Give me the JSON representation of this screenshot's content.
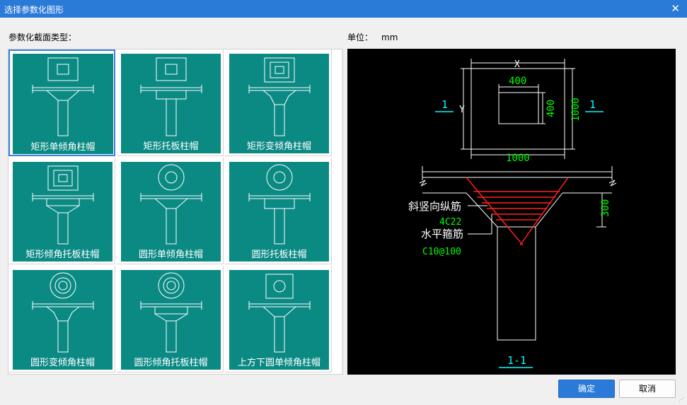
{
  "window": {
    "title": "选择参数化图形",
    "close_glyph": "✕"
  },
  "section_label": "参数化截面类型：",
  "unit": {
    "label": "单位：",
    "value": "mm"
  },
  "tiles": [
    {
      "label": "矩形单倾角柱帽",
      "icon": "rect-single-taper-cap",
      "selected": true
    },
    {
      "label": "矩形托板柱帽",
      "icon": "rect-drop-panel-cap"
    },
    {
      "label": "矩形变倾角柱帽",
      "icon": "rect-variable-taper-cap"
    },
    {
      "label": "矩形倾角托板柱帽",
      "icon": "rect-taper-drop-panel-cap"
    },
    {
      "label": "圆形单倾角柱帽",
      "icon": "round-single-taper-cap"
    },
    {
      "label": "圆形托板柱帽",
      "icon": "round-drop-panel-cap"
    },
    {
      "label": "圆形变倾角柱帽",
      "icon": "round-variable-taper-cap"
    },
    {
      "label": "圆形倾角托板柱帽",
      "icon": "round-taper-drop-panel-cap"
    },
    {
      "label": "上方下圆单倾角柱帽",
      "icon": "square-top-round-bottom-cap"
    }
  ],
  "preview": {
    "dim_x": "X",
    "dim_y": "Y",
    "inner_w": "400",
    "inner_h": "400",
    "outer_w": "1000",
    "outer_h": "1000",
    "section_mark": "1",
    "depth": "300",
    "rebar_label_1": "斜竖向纵筋",
    "rebar_value_1": "4C22",
    "rebar_label_2": "水平箍筋",
    "rebar_value_2": "C10@100",
    "section_title": "1-1",
    "colors": {
      "green": "#00ff00",
      "cyan": "#00ffff",
      "red": "#ff2020",
      "white": "#ffffff"
    }
  },
  "buttons": {
    "ok": "确定",
    "cancel": "取消"
  },
  "scroll": {
    "up": "▲",
    "down": "▼"
  }
}
